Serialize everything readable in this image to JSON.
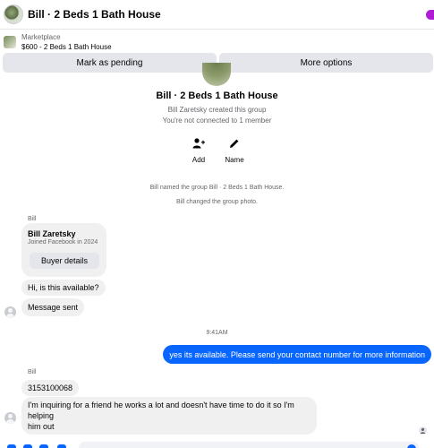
{
  "header": {
    "title": "Bill · 2 Beds 1 Bath House"
  },
  "listing": {
    "source": "Marketplace",
    "price_title": "$600 - 2 Beds 1 Bath House"
  },
  "actions": {
    "mark_pending": "Mark as pending",
    "more_options": "More options"
  },
  "group": {
    "title": "Bill · 2 Beds 1 Bath House",
    "created_by": "Bill Zaretsky created this group",
    "connection": "You're not connected to 1 member",
    "add_label": "Add",
    "name_label": "Name"
  },
  "system_messages": [
    "Bill named the group Bill · 2 Beds 1 Bath House.",
    "Bill changed the group photo."
  ],
  "thread": {
    "sender_first": "Bill",
    "profile_card": {
      "name": "Bill Zaretsky",
      "joined": "Joined Facebook in 2024",
      "button": "Buyer details"
    },
    "msg_available": "Hi, is this available?",
    "msg_sent": "Message sent",
    "timestamp": "9:41AM",
    "outgoing": "yes its available. Please send your contact number for more information",
    "sender_second": "Bill",
    "msg_number": "3153100068",
    "msg_friend_line1": "I'm inquiring for a friend he works a lot and doesn't have time to do it so I'm helping",
    "msg_friend_line2": "him out"
  },
  "colors": {
    "accent": "#0866ff",
    "bubble": "#f0f0f0",
    "secondary_text": "#65676b",
    "brand_dot": "#b01bd4"
  },
  "icons": [
    "person-add-icon",
    "pencil-icon",
    "user-avatar-icon",
    "seen-avatar-icon"
  ]
}
